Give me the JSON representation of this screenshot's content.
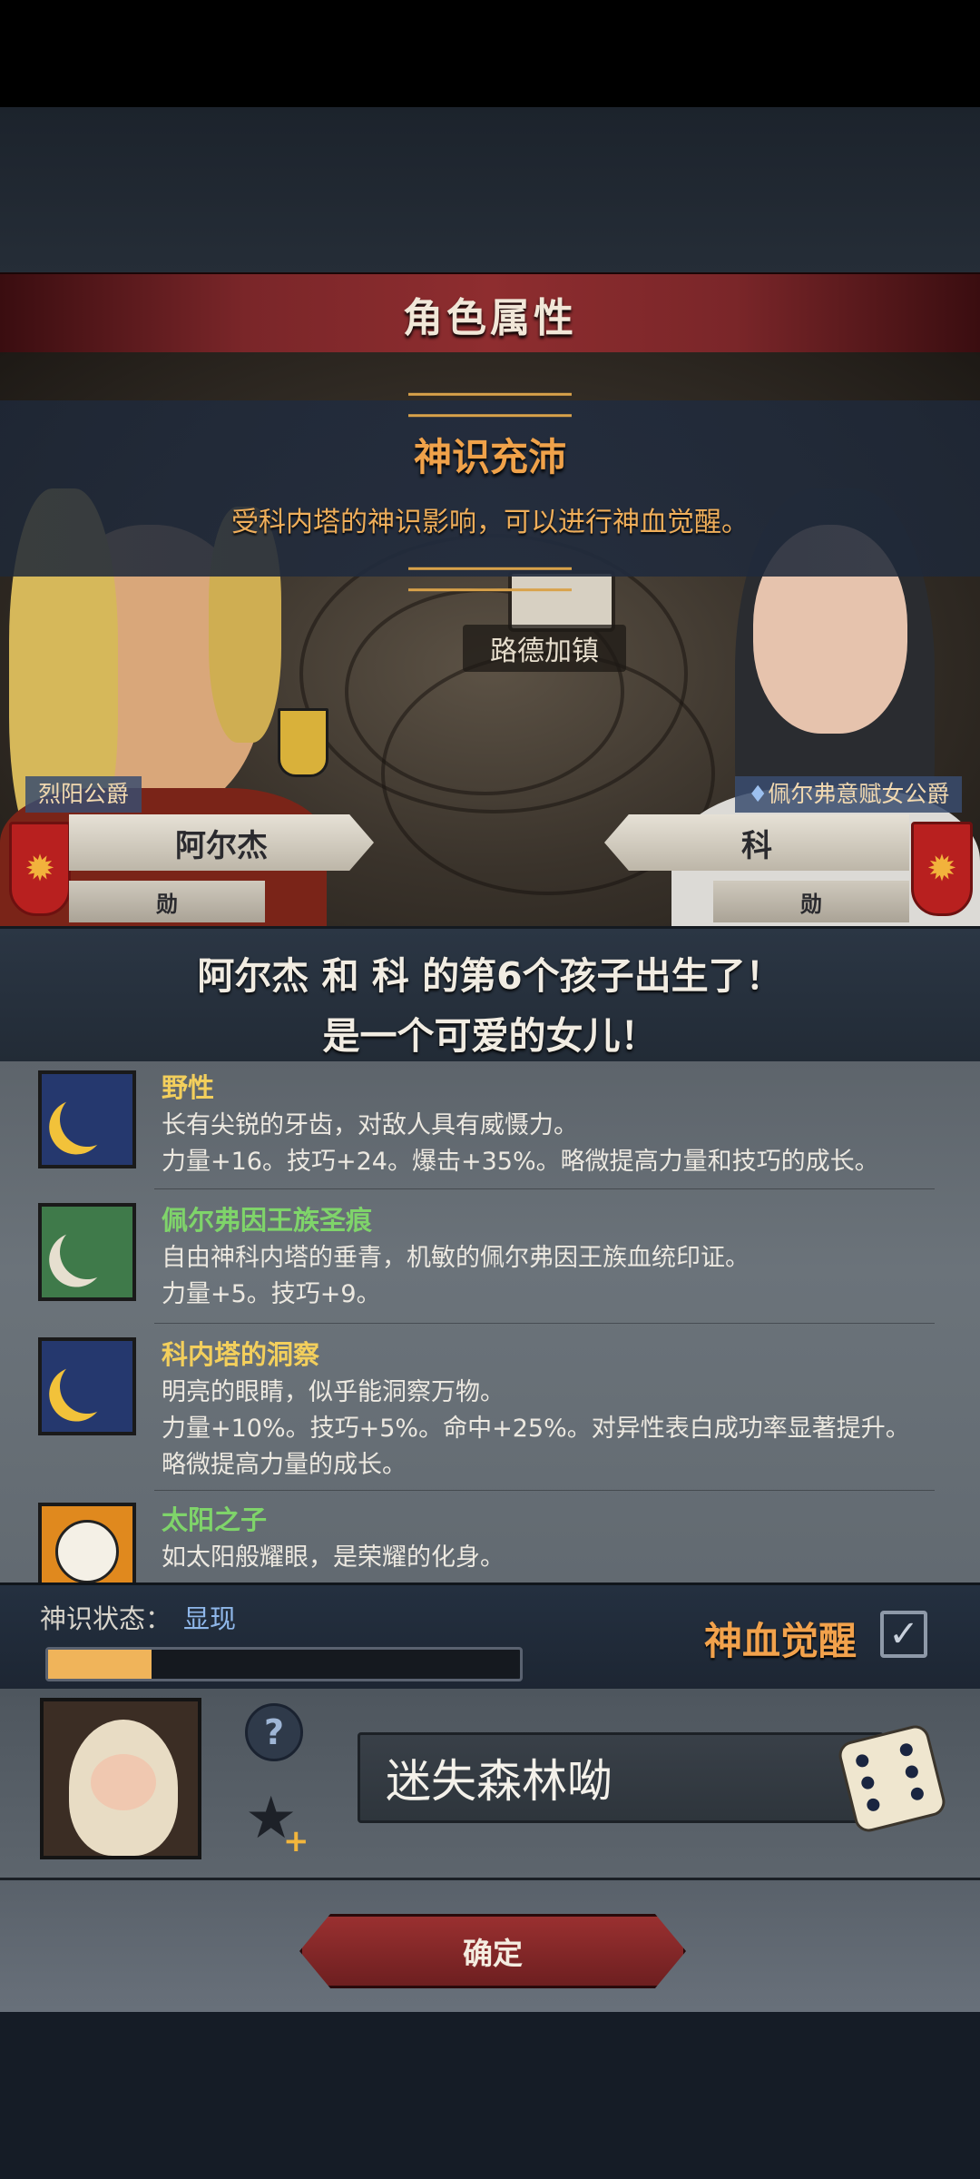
{
  "header": {
    "title": "角色属性"
  },
  "banner": {
    "title": "神识充沛",
    "text": "受科内塔的神识影响，可以进行神血觉醒。"
  },
  "scene": {
    "town": "路德加镇"
  },
  "father": {
    "title": "烈阳公爵",
    "name": "阿尔杰",
    "sub": "勋"
  },
  "mother": {
    "title": "佩尔弗意赋女公爵",
    "name": "科",
    "sub": "勋"
  },
  "announce": {
    "line1": "阿尔杰 和 科 的第6个孩子出生了！",
    "line2": "是一个可爱的女儿！"
  },
  "traits": [
    {
      "name": "野性",
      "name_color": "#f3cf5c",
      "icon": "crescent-moon-icon",
      "lines": [
        "长有尖锐的牙齿，对敌人具有威慑力。",
        "力量+16。技巧+24。爆击+35%。略微提高力量和技巧的成长。"
      ]
    },
    {
      "name": "佩尔弗因王族圣痕",
      "name_color": "#7fd46a",
      "icon": "silver-crescent-icon",
      "lines": [
        "自由神科内塔的垂青，机敏的佩尔弗因王族血统印证。",
        "力量+5。技巧+9。"
      ]
    },
    {
      "name": "科内塔的洞察",
      "name_color": "#f3cf5c",
      "icon": "crescent-moon-icon",
      "lines": [
        "明亮的眼睛，似乎能洞察万物。",
        "力量+10%。技巧+5%。命中+25%。对异性表白成功率显著提升。",
        "略微提高力量的成长。"
      ]
    },
    {
      "name": "太阳之子",
      "name_color": "#7fd46a",
      "icon": "sun-face-icon",
      "lines": [
        "如太阳般耀眼，是荣耀的化身。"
      ]
    }
  ],
  "status": {
    "label": "神识状态：",
    "value": "显现",
    "progress": 0.22,
    "awaken_label": "神血觉醒",
    "awaken_checked": true
  },
  "child": {
    "name": "迷失森林呦"
  },
  "confirm_label": "确定",
  "colors": {
    "accent": "#f0a24a",
    "title_bar": "#8e2d2f",
    "progress": "#f0b45a"
  }
}
